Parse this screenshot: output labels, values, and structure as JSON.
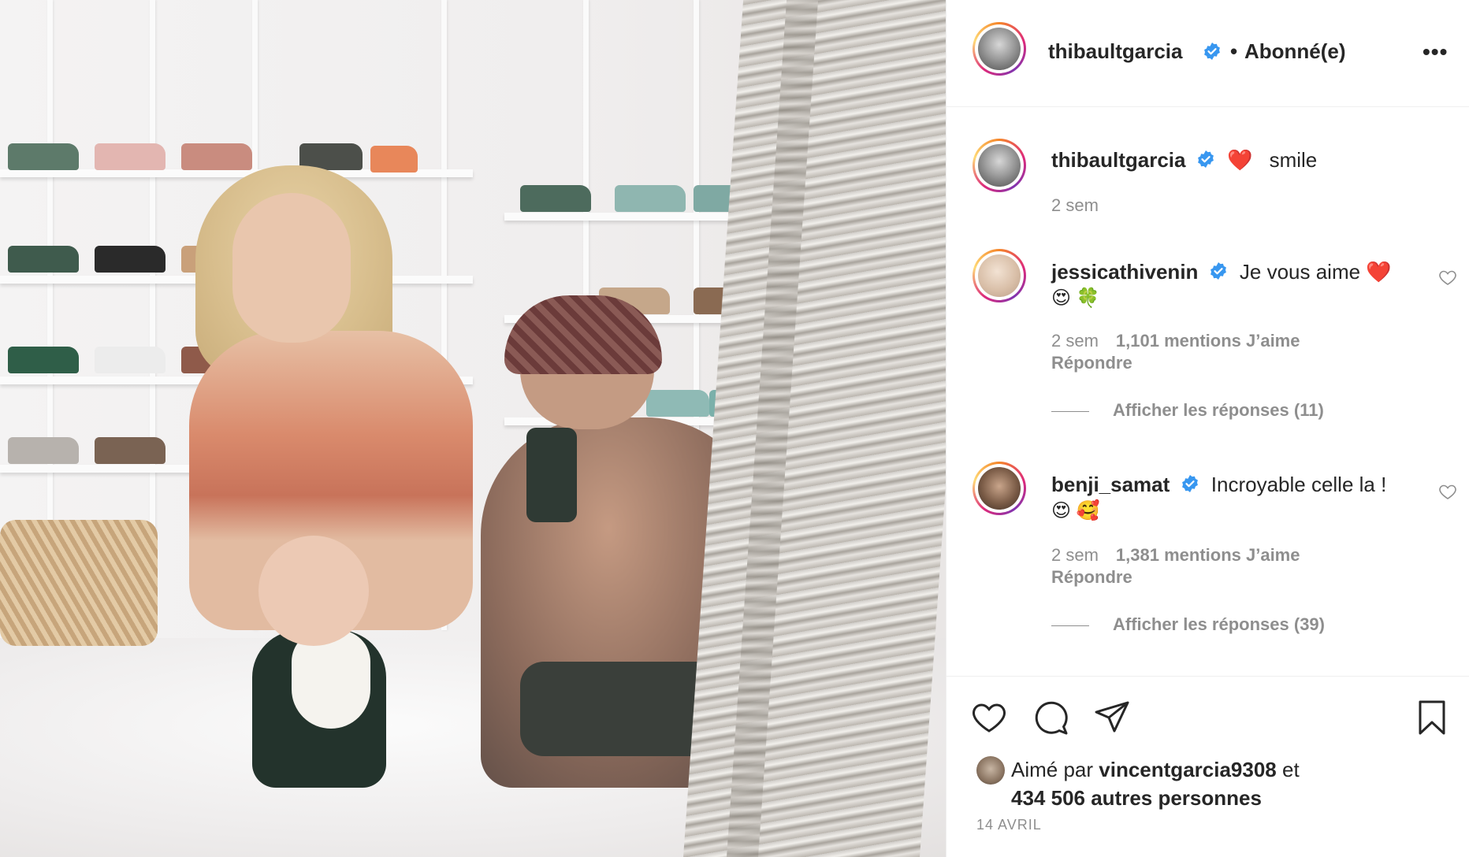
{
  "post": {
    "author": "thibaultgarcia",
    "follow_status": "Abonné(e)",
    "separator": "•"
  },
  "caption": {
    "username": "thibaultgarcia",
    "emoji": "❤️",
    "text": "smile",
    "time": "2 sem"
  },
  "comments": [
    {
      "username": "jessicathivenin",
      "text": "Je vous aime ❤️",
      "emoji_line": "😍 🍀",
      "time": "2 sem",
      "likes": "1,101 mentions J’aime",
      "reply": "Répondre",
      "view_replies": "Afficher les réponses (11)"
    },
    {
      "username": "benji_samat",
      "text": "Incroyable celle la !",
      "emoji_line": "😍 🥰",
      "time": "2 sem",
      "likes": "1,381 mentions J’aime",
      "reply": "Répondre",
      "view_replies": "Afficher les réponses (39)"
    }
  ],
  "likes": {
    "prefix": "Aimé par",
    "user": "vincentgarcia9308",
    "suffix": "et",
    "count": "434 506 autres personnes"
  },
  "date": "14 AVRIL",
  "icons": {
    "more": "more-options-icon",
    "like": "heart-icon",
    "comment": "comment-icon",
    "share": "share-icon",
    "save": "bookmark-icon",
    "verified": "verified-badge-icon"
  },
  "colors": {
    "verified": "#3897f0",
    "text": "#262626",
    "muted": "#8e8e8e",
    "heart": "#ed4956"
  },
  "more_label": "•••"
}
